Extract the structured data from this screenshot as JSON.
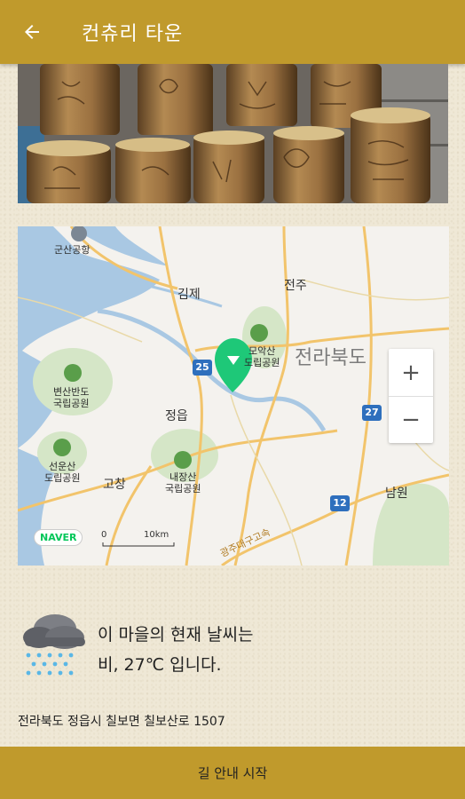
{
  "appbar": {
    "title": "컨츄리 타운",
    "back_icon": "arrow-left-icon"
  },
  "map": {
    "labels": {
      "airport": "군산공항",
      "gimje": "김제",
      "jeonju": "전주",
      "region": "전라북도",
      "moaksan": "모악산\n도립공원",
      "byeonsanbando": "변산반도\n국립공원",
      "jeongeup": "정읍",
      "seonunsan": "선운산\n도립공원",
      "gochang": "고창",
      "naejangsan": "내장산\n국립공원",
      "namwon": "남원",
      "road_25": "25",
      "road_27": "27",
      "road_12": "12",
      "expressway": "광주대구고속"
    },
    "zoom_in": "+",
    "zoom_out": "−",
    "brand": "NAVER",
    "scale_start": "0",
    "scale_end": "10km"
  },
  "weather": {
    "icon": "rain-cloud-icon",
    "line1": "이 마을의 현재 날씨는",
    "line2": "비, 27℃ 입니다."
  },
  "address": "전라북도 정읍시 칠보면 칠보산로 1507",
  "bottom_button": "길 안내 시작",
  "colors": {
    "accent": "#c09a2c",
    "marker": "#1ec878"
  }
}
